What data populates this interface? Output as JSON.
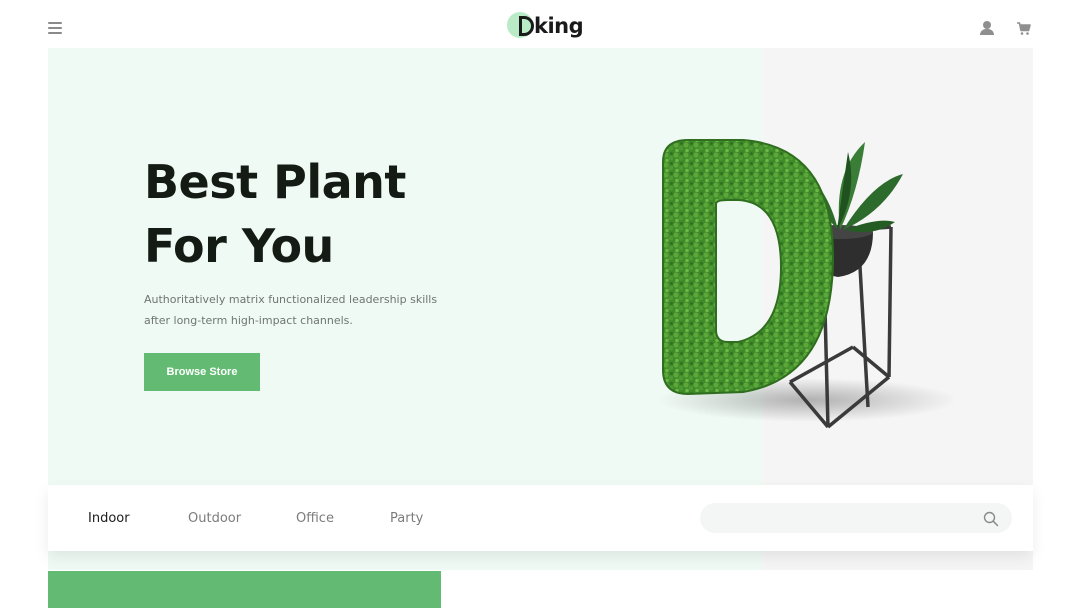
{
  "header": {
    "logo_text": "king",
    "menu_icon": "hamburger-menu-icon",
    "user_icon": "user-icon",
    "cart_icon": "cart-icon"
  },
  "hero": {
    "title_line1": "Best Plant",
    "title_line2": "For You",
    "description": "Authoritatively matrix functionalized leadership skills after long-term high-impact channels.",
    "cta_label": "Browse Store"
  },
  "categories": {
    "tabs": [
      {
        "label": "Indoor",
        "active": true
      },
      {
        "label": "Outdoor",
        "active": false
      },
      {
        "label": "Office",
        "active": false
      },
      {
        "label": "Party",
        "active": false
      }
    ],
    "search_placeholder": ""
  },
  "colors": {
    "accent": "#63bb73",
    "hero_bg": "#f0faf4",
    "logo_circle": "#b9ecc6",
    "text_dark": "#141a14"
  }
}
